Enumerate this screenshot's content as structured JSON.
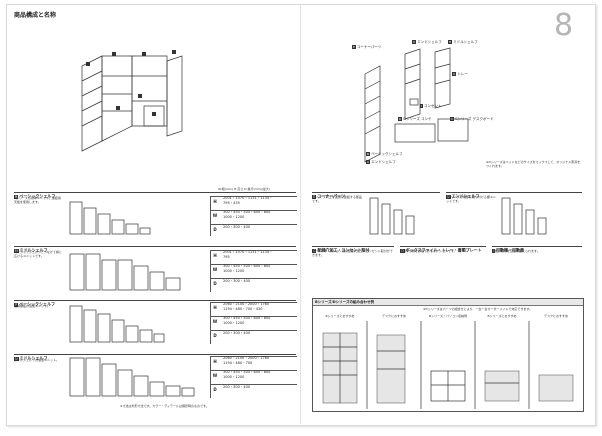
{
  "header": {
    "title": "商品構成と名称",
    "page_number": "8"
  },
  "illustration_labels": [
    {
      "tag": "E",
      "text": "コーナーパーツ"
    },
    {
      "tag": "U",
      "text": "エンドシェルフ"
    },
    {
      "tag": "H",
      "text": "ミドルシェルフ"
    },
    {
      "tag": "U",
      "text": "トレー"
    },
    {
      "tag": "I",
      "text": "コンセント"
    },
    {
      "tag": "D",
      "text": "Dシリーズ コンテ"
    },
    {
      "tag": "C",
      "text": "Cシリーズ デスクボード"
    },
    {
      "tag": "B",
      "text": "ベーシックシェルフ"
    },
    {
      "tag": "U",
      "text": "エンドシェルフ"
    }
  ],
  "illustration_note": "※Dシリーズはベッドなどのサイズをミックスして、オリジナル家具をつくれます。",
  "size_note": "W:幅(mm)  H:高さ  D:奥行(mm)(最大)",
  "sections": [
    {
      "tag": "B",
      "title": "ベーシックシェルフ",
      "desc": "Bシリーズの基本ユニット。連結用天板を使用します。",
      "specs": [
        {
          "label": "H",
          "value": "2001・1570・1131・1134・\n795・435"
        },
        {
          "label": "W",
          "value": "300・450・500・600・800\n1000・1200"
        },
        {
          "label": "D",
          "value": "200・300・400"
        }
      ]
    },
    {
      "tag": "H",
      "title": "ミドルシェルフ",
      "desc": "ベーシックシェルフとつなげて横に広げるユニットです。",
      "specs": [
        {
          "label": "H",
          "value": "2001・1570・1131・1134・\n795"
        },
        {
          "label": "W",
          "value": "300・450・500・600・800\n1000・1200"
        },
        {
          "label": "D",
          "value": "200・300・400"
        }
      ]
    },
    {
      "tag": "P",
      "title": "ベーシックシェルフ",
      "desc": "収納棚板の追加ユニット。",
      "specs": [
        {
          "label": "H",
          "value": "2060・2100・2000・1760\n1194・480・700・430"
        },
        {
          "label": "W",
          "value": "300・450・500・600・800\n1000・1200"
        },
        {
          "label": "D",
          "value": "200・300・400"
        }
      ]
    },
    {
      "tag": "U",
      "title": "ミドルシェルフ",
      "desc": "ミドルシェルフの追加ユニット。",
      "specs": [
        {
          "label": "H",
          "value": "2060・2100・2000・1760\n1194・480・700"
        },
        {
          "label": "W",
          "value": "300・450・500・600・800\n1000・1200"
        },
        {
          "label": "D",
          "value": "200・300・400"
        }
      ]
    }
  ],
  "left_footnote": "※寸法は外形寸法です。カラー・ディテールは撮影時のものです。",
  "right_sections": [
    {
      "tag": "E",
      "title": "コーナーパーツ",
      "desc": "Bシリーズ同士を直角に連結する部品です。"
    },
    {
      "tag": "U",
      "title": "エンドシェルフ",
      "desc": "Bシリーズの端部に取り付ける棚ユニットです。"
    },
    {
      "tag": "C",
      "title": "配線穴加工・コンセント取付",
      "desc": "オーディオ・パソコン用の配線穴加工やコンセント取付ができます。"
    },
    {
      "tag": "D",
      "title": "ボックスファイル・トレー・書類プレート",
      "desc": "書類や小物を整理できるオプションです。"
    },
    {
      "tag": "I",
      "title": "可動棚・可動扉",
      "desc": "棚板の高さを自由に変えられます。"
    }
  ],
  "comparison": {
    "title": "Bシリーズ/Dシリーズの組み合わせ例",
    "note": "※Dシリーズはパーツの組合せにより、一台一台オーダーメイドで対応できます。",
    "columns": [
      "Bシリーズにおすすめ",
      "デスクにおすすめ",
      "Bシリーズ・パソコン収納例",
      "Bシリーズにおすすめ",
      "デスクにおすすめ"
    ]
  }
}
